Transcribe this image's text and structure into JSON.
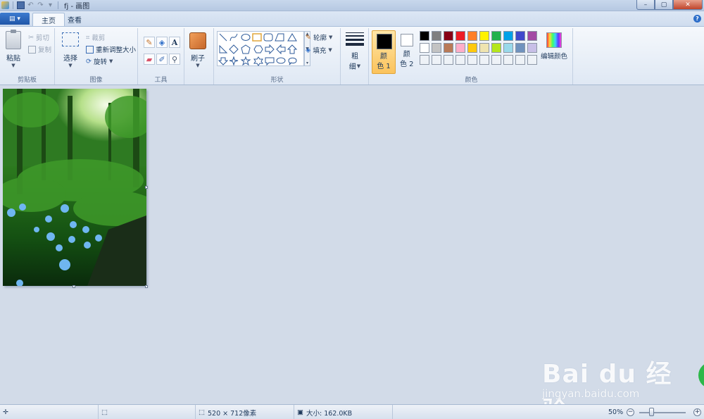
{
  "window": {
    "title": "fj - 画图",
    "minimize": "–",
    "maximize": "▢",
    "close": "✕"
  },
  "tabs": [
    {
      "label": "主页",
      "active": true
    },
    {
      "label": "查看",
      "active": false
    }
  ],
  "app_menu_label": "▤ ▾",
  "help_label": "?",
  "ribbon": {
    "clipboard": {
      "group_label": "剪贴板",
      "paste": "粘贴",
      "cut": "剪切",
      "copy": "复制"
    },
    "image": {
      "group_label": "图像",
      "select": "选择",
      "crop": "裁剪",
      "resize": "重新调整大小",
      "rotate": "旋转"
    },
    "tools": {
      "group_label": "工具"
    },
    "brushes": {
      "label": "刷子"
    },
    "shapes": {
      "group_label": "形状",
      "outline": "轮廓",
      "fill": "填充"
    },
    "size": {
      "label_1": "粗",
      "label_2": "细"
    },
    "colors": {
      "group_label": "颜色",
      "color1_label_1": "颜",
      "color1_label_2": "色 1",
      "color2_label_1": "颜",
      "color2_label_2": "色 2",
      "edit_colors": "编辑颜色",
      "color1": "#000000",
      "color2": "#ffffff",
      "palette_row1": [
        "#000000",
        "#7f7f7f",
        "#880015",
        "#ed1c24",
        "#ff7f27",
        "#fff200",
        "#22b14c",
        "#00a2e8",
        "#3f48cc",
        "#a349a4"
      ],
      "palette_row2": [
        "#ffffff",
        "#c3c3c3",
        "#b97a57",
        "#ffaec9",
        "#ffc90e",
        "#efe4b0",
        "#b5e61d",
        "#99d9ea",
        "#7092be",
        "#c8bfe7"
      ]
    }
  },
  "status": {
    "image_size": "520 × 712像素",
    "file_size": "大小: 162.0KB",
    "zoom": "50%",
    "zoom_out": "−",
    "zoom_in": "+"
  },
  "watermark": {
    "brand": "Bai du 经验",
    "url": "jingyan.baidu.com"
  }
}
